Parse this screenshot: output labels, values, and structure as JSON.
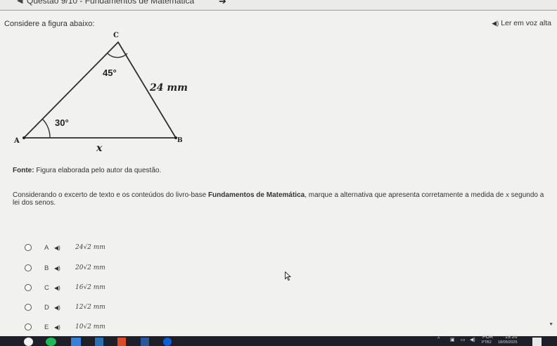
{
  "header": {
    "back_icon": "back-arrow-icon",
    "title": "Questão 9/10 - Fundamentos de Matemática",
    "title_arrow": "➔"
  },
  "prompt": "Considere a figura abaixo:",
  "tts": {
    "icon": "◀)",
    "label": "Ler em voz alta"
  },
  "figure": {
    "vertex_c": "C",
    "vertex_a": "A",
    "vertex_b": "B",
    "angle_c": "45°",
    "angle_a": "30°",
    "side_bc": "24 mm",
    "side_ab": "x"
  },
  "source": {
    "label": "Fonte:",
    "text": " Figura elaborada pelo autor da questão."
  },
  "question": {
    "before": "Considerando o excerto de texto e os conteúdos do livro-base ",
    "bold": "Fundamentos de Matemática",
    "middle": ", marque a alternativa que apresenta corretamente a medida de ",
    "var": "x",
    "after": " segundo a lei dos senos."
  },
  "options": [
    {
      "letter": "A",
      "speaker": "◀)",
      "value": "24√2 mm"
    },
    {
      "letter": "B",
      "speaker": "◀)",
      "value": "20√2 mm"
    },
    {
      "letter": "C",
      "speaker": "◀)",
      "value": "16√2 mm"
    },
    {
      "letter": "D",
      "speaker": "◀)",
      "value": "12√2 mm"
    },
    {
      "letter": "E",
      "speaker": "◀)",
      "value": "10√2 mm"
    }
  ],
  "taskbar": {
    "lang": "POR",
    "time": "19:20",
    "keyboard": "PTB2",
    "date": "18/05/2025"
  },
  "colors": {
    "taskbar": "#1f1f29",
    "page": "#f1f1ef"
  }
}
